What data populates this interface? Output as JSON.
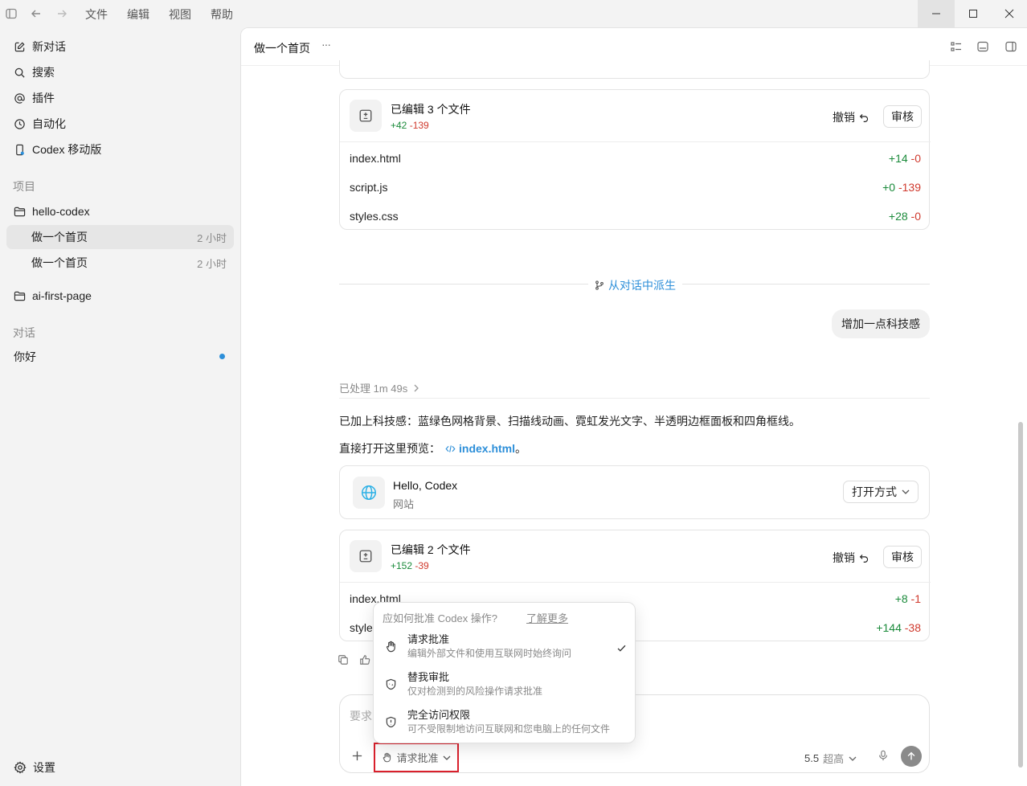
{
  "titlebar": {
    "menus": [
      "文件",
      "编辑",
      "视图",
      "帮助"
    ]
  },
  "sidebar": {
    "nav": [
      {
        "label": "新对话",
        "icon": "edit-icon"
      },
      {
        "label": "搜索",
        "icon": "search-icon"
      },
      {
        "label": "插件",
        "icon": "at-icon"
      },
      {
        "label": "自动化",
        "icon": "clock-icon"
      },
      {
        "label": "Codex 移动版",
        "icon": "phone-icon"
      }
    ],
    "projects_label": "项目",
    "projects": [
      {
        "name": "hello-codex",
        "threads": [
          {
            "title": "做一个首页",
            "time": "2 小时"
          },
          {
            "title": "做一个首页",
            "time": "2 小时"
          }
        ]
      },
      {
        "name": "ai-first-page"
      }
    ],
    "chats_label": "对话",
    "chats": [
      {
        "title": "你好",
        "unread": true
      }
    ],
    "settings_label": "设置"
  },
  "header": {
    "title": "做一个首页",
    "more": "···"
  },
  "edit_card_1": {
    "title": "已编辑 3 个文件",
    "added": "+42",
    "removed": "-139",
    "undo": "撤销",
    "review": "审核",
    "files": [
      {
        "name": "index.html",
        "added": "+14",
        "removed": "-0"
      },
      {
        "name": "script.js",
        "added": "+0",
        "removed": "-139"
      },
      {
        "name": "styles.css",
        "added": "+28",
        "removed": "-0"
      }
    ]
  },
  "fork_label": "从对话中派生",
  "user_message": "增加一点科技感",
  "processed": "已处理 1m 49s",
  "reply": {
    "line1": "已加上科技感：蓝绿色网格背景、扫描线动画、霓虹发光文字、半透明边框面板和四角框线。",
    "line2_prefix": "直接打开这里预览：",
    "link": "index.html",
    "line2_suffix": "。"
  },
  "site_card": {
    "title": "Hello, Codex",
    "subtitle": "网站",
    "open_with": "打开方式"
  },
  "edit_card_2": {
    "title": "已编辑 2 个文件",
    "added": "+152",
    "removed": "-39",
    "undo": "撤销",
    "review": "审核",
    "files": [
      {
        "name": "index.html",
        "added": "+8",
        "removed": "-1"
      },
      {
        "name": "styles.css",
        "name_visible": "styles",
        "added": "+144",
        "removed": "-38"
      }
    ]
  },
  "approval_popup": {
    "question": "应如何批准 Codex 操作?",
    "learn_more": "了解更多",
    "options": [
      {
        "title": "请求批准",
        "desc": "编辑外部文件和使用互联网时始终询问",
        "selected": true
      },
      {
        "title": "替我审批",
        "desc": "仅对检测到的风险操作请求批准",
        "selected": false
      },
      {
        "title": "完全访问权限",
        "desc": "可不受限制地访问互联网和您电脑上的任何文件",
        "selected": false
      }
    ]
  },
  "composer": {
    "placeholder": "要求",
    "approval_mode": "请求批准",
    "model": "5.5",
    "reasoning": "超高"
  },
  "colors": {
    "accent_blue": "#2d8fd9",
    "add_green": "#1a8a3a",
    "del_red": "#d03a2e",
    "highlight_box": "#d9202c"
  }
}
